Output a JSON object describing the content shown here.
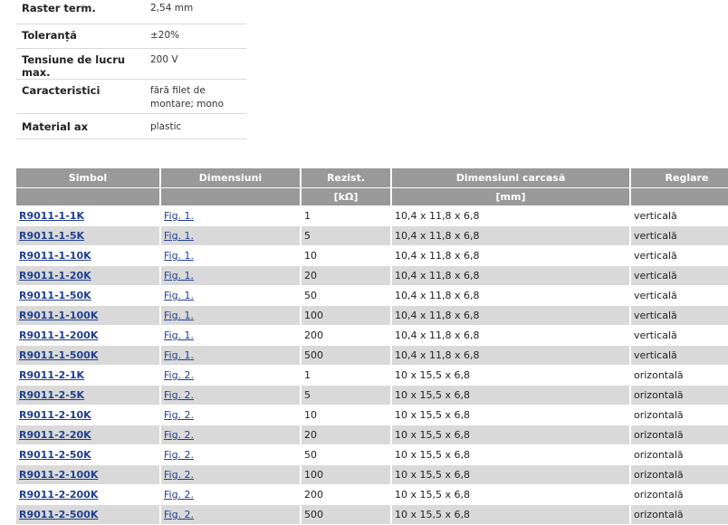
{
  "specs": [
    {
      "label": "Raster term.",
      "value": "2,54 mm"
    },
    {
      "label": "Toleranță",
      "value": "±20%"
    },
    {
      "label": "Tensiune de lucru max.",
      "value": "200 V"
    },
    {
      "label": "Caracteristici",
      "value": "fără filet de montare; mono"
    },
    {
      "label": "Material ax",
      "value": "plastic"
    }
  ],
  "table": {
    "headers": [
      "Simbol",
      "Dimensiuni",
      "Rezist.",
      "Dimensiuni carcasă",
      "Reglare"
    ],
    "units": [
      "",
      "",
      "[kΩ]",
      "[mm]",
      ""
    ],
    "rows": [
      {
        "symbol": "R9011-1-1K",
        "fig": "Fig. 1.",
        "rezist": "1",
        "dim": "10,4 x 11,8 x 6,8",
        "reglare": "verticală"
      },
      {
        "symbol": "R9011-1-5K",
        "fig": "Fig. 1.",
        "rezist": "5",
        "dim": "10,4 x 11,8 x 6,8",
        "reglare": "verticală"
      },
      {
        "symbol": "R9011-1-10K",
        "fig": "Fig. 1.",
        "rezist": "10",
        "dim": "10,4 x 11,8 x 6,8",
        "reglare": "verticală"
      },
      {
        "symbol": "R9011-1-20K",
        "fig": "Fig. 1.",
        "rezist": "20",
        "dim": "10,4 x 11,8 x 6,8",
        "reglare": "verticală"
      },
      {
        "symbol": "R9011-1-50K",
        "fig": "Fig. 1.",
        "rezist": "50",
        "dim": "10,4 x 11,8 x 6,8",
        "reglare": "verticală"
      },
      {
        "symbol": "R9011-1-100K",
        "fig": "Fig. 1.",
        "rezist": "100",
        "dim": "10,4 x 11,8 x 6,8",
        "reglare": "verticală"
      },
      {
        "symbol": "R9011-1-200K",
        "fig": "Fig. 1.",
        "rezist": "200",
        "dim": "10,4 x 11,8 x 6,8",
        "reglare": "verticală"
      },
      {
        "symbol": "R9011-1-500K",
        "fig": "Fig. 1.",
        "rezist": "500",
        "dim": "10,4 x 11,8 x 6,8",
        "reglare": "verticală"
      },
      {
        "symbol": "R9011-2-1K",
        "fig": "Fig. 2.",
        "rezist": "1",
        "dim": "10 x 15,5 x 6,8",
        "reglare": "orizontală"
      },
      {
        "symbol": "R9011-2-5K",
        "fig": "Fig. 2.",
        "rezist": "5",
        "dim": "10 x 15,5 x 6,8",
        "reglare": "orizontală"
      },
      {
        "symbol": "R9011-2-10K",
        "fig": "Fig. 2.",
        "rezist": "10",
        "dim": "10 x 15,5 x 6,8",
        "reglare": "orizontală"
      },
      {
        "symbol": "R9011-2-20K",
        "fig": "Fig. 2.",
        "rezist": "20",
        "dim": "10 x 15,5 x 6,8",
        "reglare": "orizontală"
      },
      {
        "symbol": "R9011-2-50K",
        "fig": "Fig. 2.",
        "rezist": "50",
        "dim": "10 x 15,5 x 6,8",
        "reglare": "orizontală"
      },
      {
        "symbol": "R9011-2-100K",
        "fig": "Fig. 2.",
        "rezist": "100",
        "dim": "10 x 15,5 x 6,8",
        "reglare": "orizontală"
      },
      {
        "symbol": "R9011-2-200K",
        "fig": "Fig. 2.",
        "rezist": "200",
        "dim": "10 x 15,5 x 6,8",
        "reglare": "orizontală"
      },
      {
        "symbol": "R9011-2-500K",
        "fig": "Fig. 2.",
        "rezist": "500",
        "dim": "10 x 15,5 x 6,8",
        "reglare": "orizontală"
      }
    ]
  }
}
